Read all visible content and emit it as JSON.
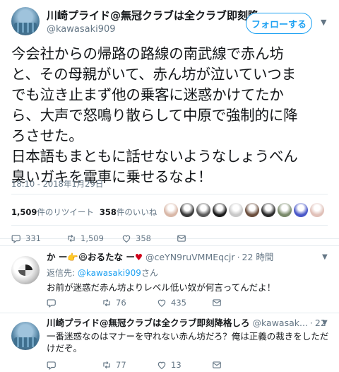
{
  "tweet": {
    "name": "川崎プライド@無冠クラブは全クラブ即刻降格しろ",
    "handle": "@kawasaki909",
    "follow_label": "フォローする",
    "text": "今会社からの帰路の路線の南武線で赤ん坊\nと、その母親がいて、赤ん坊が泣いていつま\nでも泣き止まず他の乗客に迷惑かけてたか\nら、大声で怒鳴り散らして中原で強制的に降\nろさせた。\n日本語もまともに話せないようなしょうべん\n臭いガキを電車に乗せるなよ！",
    "timestamp": "18:10 - 2018年1月29日",
    "retweets_count": "1,509",
    "retweets_label": "件のリツイート",
    "likes_count": "358",
    "likes_label": "件のいいね",
    "liker_colors": [
      "#d9b8a8",
      "#3a3a3a",
      "#5a5a5a",
      "#1c1c1c",
      "#c8c8c8",
      "#6b4e3d",
      "#2b2b2b",
      "#7a8a6a",
      "#4a58c8",
      "#e0c0b8"
    ],
    "actions": {
      "replies": "331",
      "retweets": "1,509",
      "likes": "358"
    }
  },
  "replies": [
    {
      "name_prefix": "か ー",
      "name_middle": "おるたな ー",
      "emoji1": "👉",
      "emoji2": "😆",
      "emoji3": "♥",
      "handle": "@ceYN9ruVMMEqcjr",
      "time": "22 時間",
      "reply_to_label": "返信先:",
      "reply_to_handle": "@kawasaki909",
      "reply_to_suffix": "さん",
      "text": "お前が迷惑だ赤ん坊よりレベル低い奴が何言ってんだよ！",
      "actions": {
        "replies": "",
        "retweets": "76",
        "likes": "435"
      }
    },
    {
      "name": "川崎プライド@無冠クラブは全クラブ即刻降格しろ",
      "handle": "@kawasak...",
      "time": "22 時間",
      "text": "一番迷惑なのはマナーを守れない赤ん坊だろ？俺は正義の裁きをしただけだぞ。",
      "actions": {
        "replies": "",
        "retweets": "77",
        "likes": "13"
      }
    }
  ],
  "colors": {
    "accent": "#1da1f2",
    "muted": "#657786",
    "heart": "#e0245e",
    "text": "#14171a"
  }
}
